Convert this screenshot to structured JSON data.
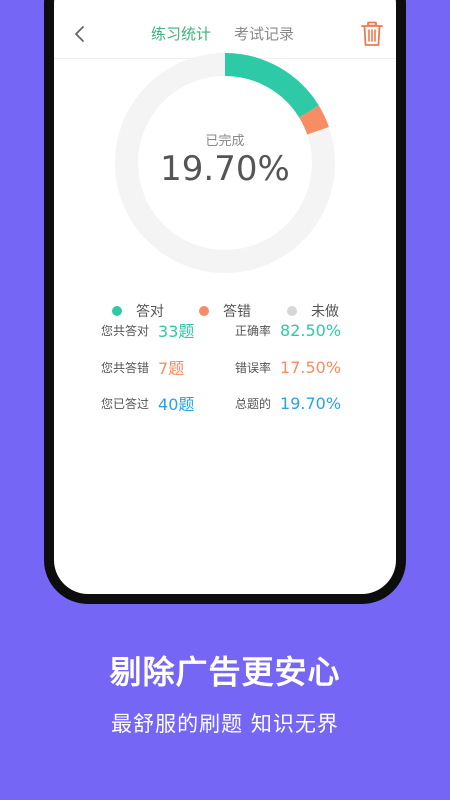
{
  "header": {
    "tab_active": "练习统计",
    "tab_inactive": "考试记录"
  },
  "summary": {
    "completed_label": "已完成",
    "completed_percent": "19.70%"
  },
  "chart_data": {
    "type": "pie",
    "categories": [
      "答对",
      "答错",
      "未做"
    ],
    "values": [
      16.25,
      3.45,
      80.3
    ],
    "colors": [
      "#2ec9a7",
      "#f78d63",
      "#f4f4f4"
    ]
  },
  "legend": [
    {
      "label": "答对",
      "color": "#2ec9a7"
    },
    {
      "label": "答错",
      "color": "#f78d63"
    },
    {
      "label": "未做",
      "color": "#d6d6d6"
    }
  ],
  "stats": {
    "correct_label": "您共答对",
    "correct_value": "33题",
    "wrong_label": "您共答错",
    "wrong_value": "7题",
    "answered_label": "您已答过",
    "answered_value": "40题",
    "accuracy_label": "正确率",
    "accuracy_value": "82.50%",
    "error_label": "错误率",
    "error_value": "17.50%",
    "total_label": "总题的",
    "total_value": "19.70%"
  },
  "colors": {
    "green": "#2ec9a7",
    "orange": "#f78d63",
    "blue": "#2aa3e3",
    "tab_active": "#3cb37a",
    "trash": "#f07a4c",
    "background": "#7666f6"
  },
  "captions": {
    "headline": "剔除广告更安心",
    "subline": "最舒服的刷题 知识无界"
  }
}
